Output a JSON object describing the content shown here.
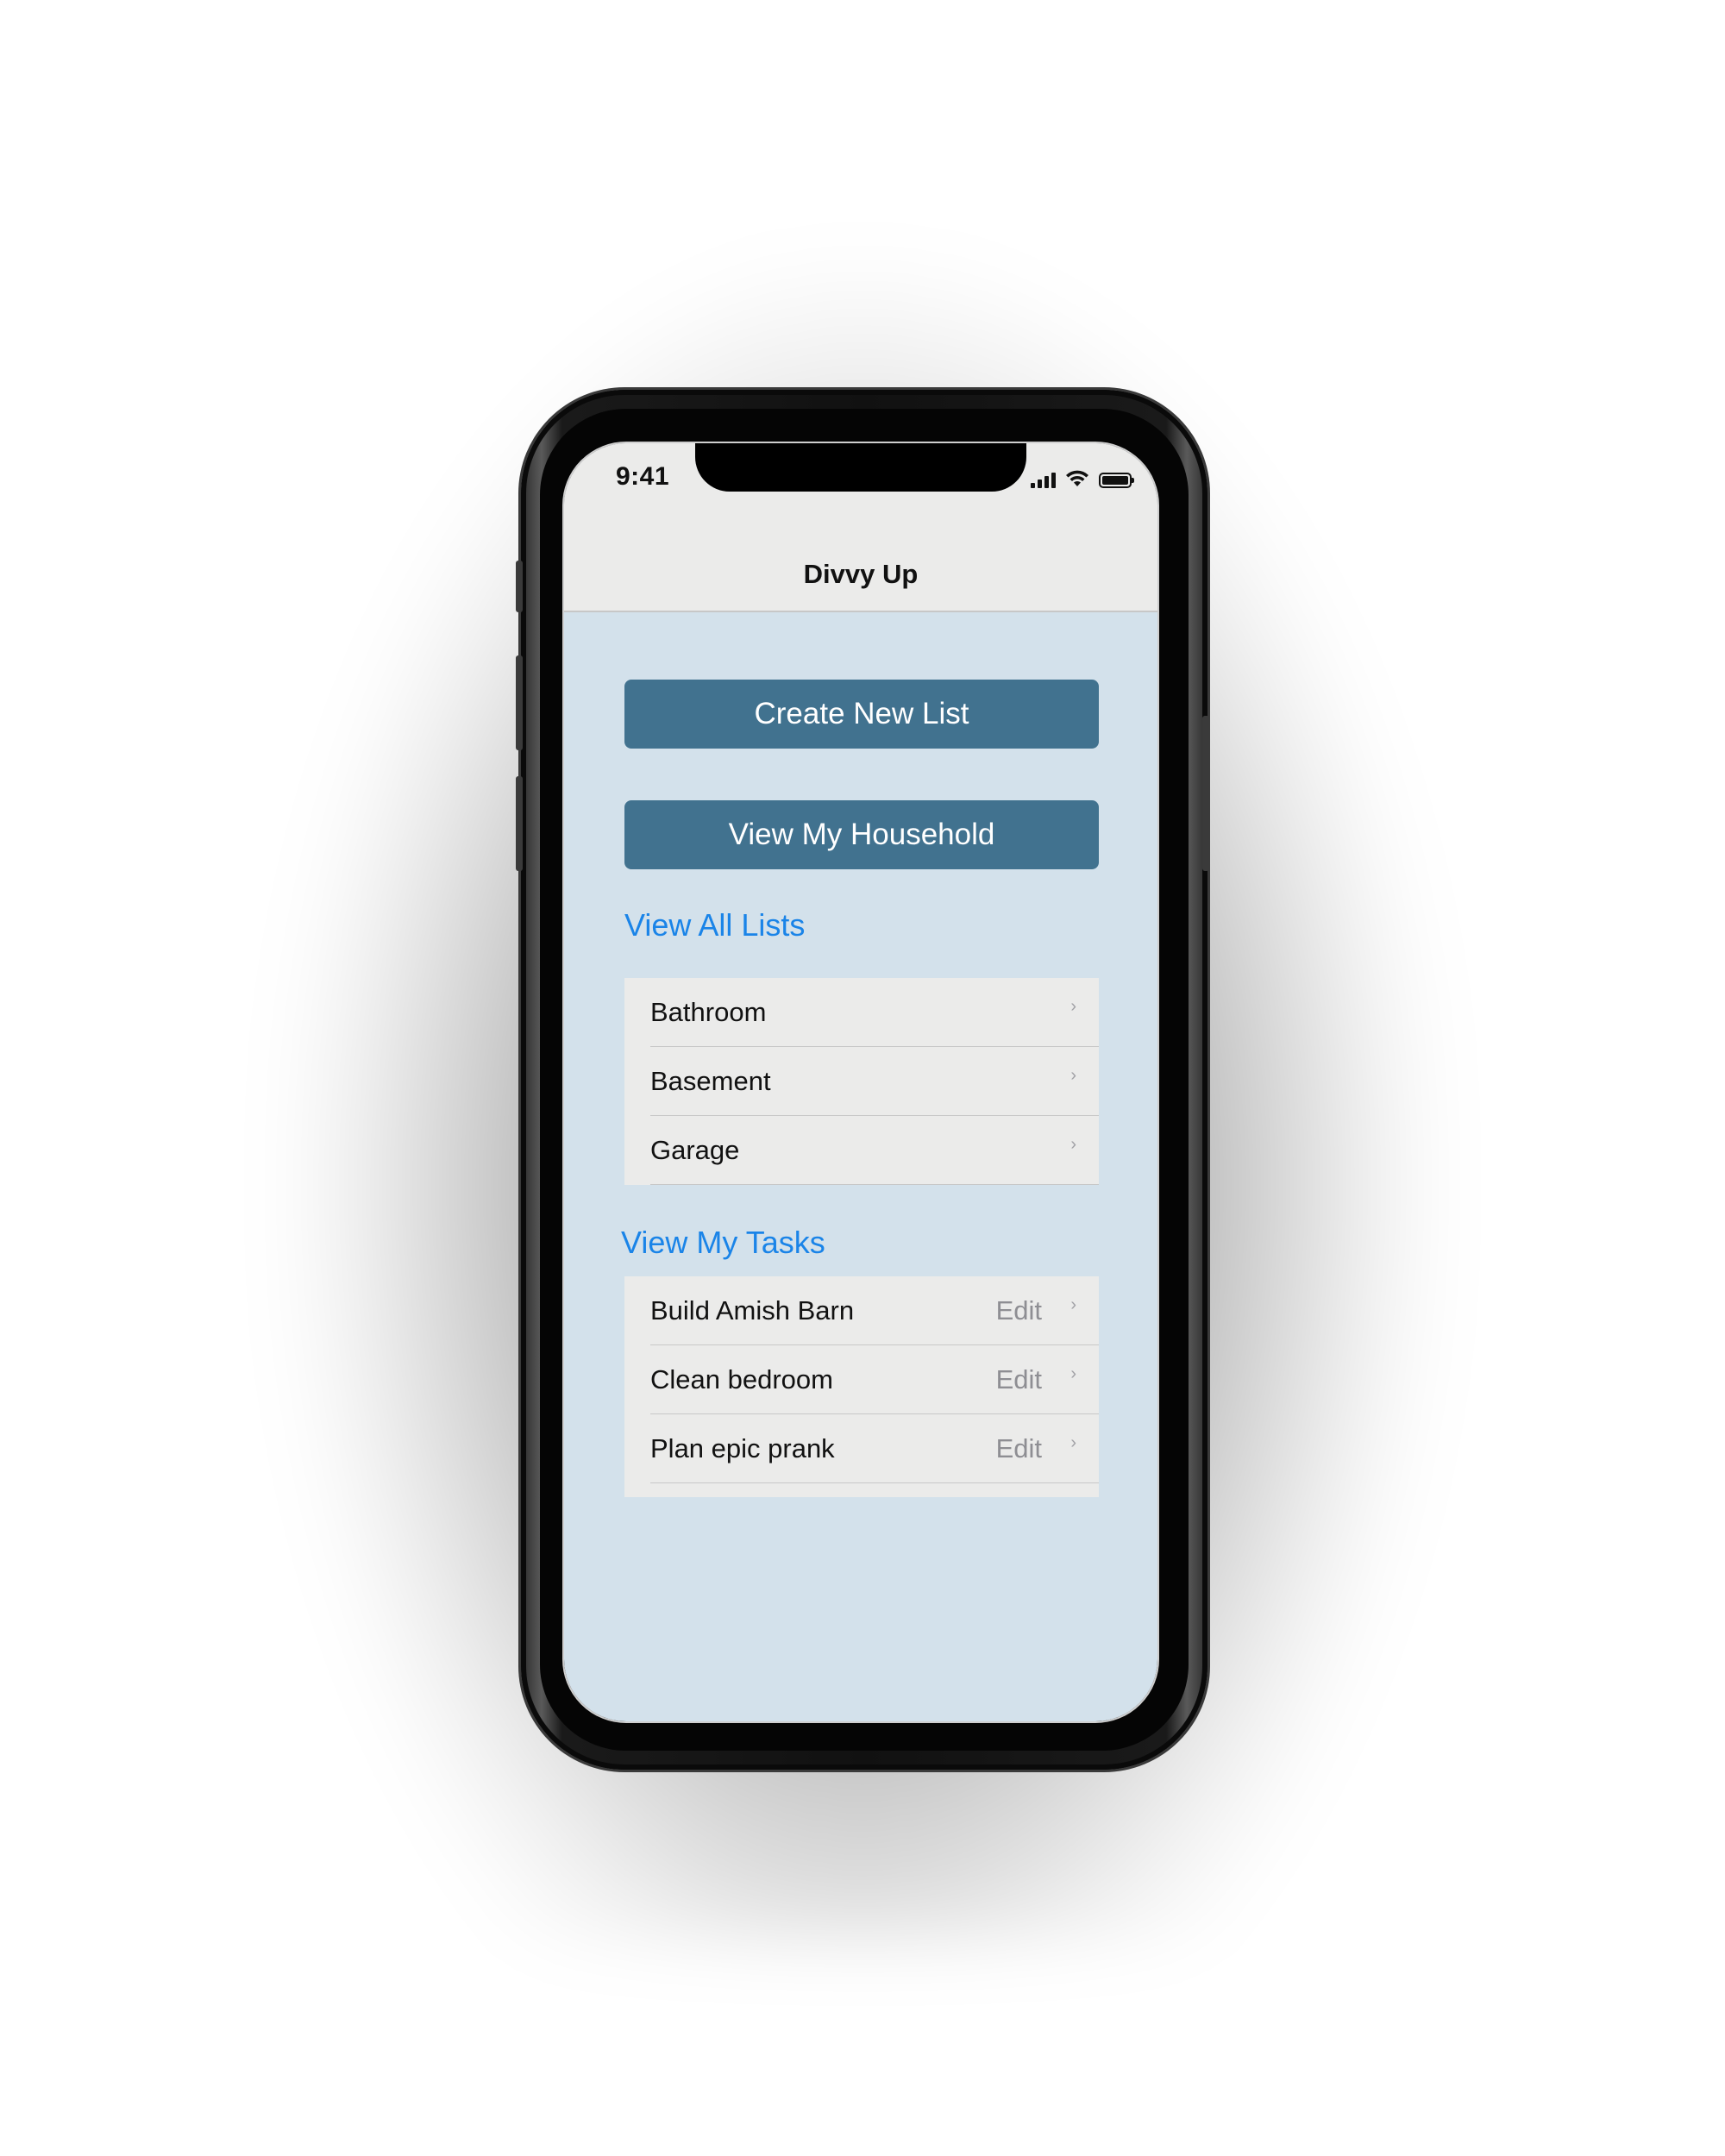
{
  "status_bar": {
    "time": "9:41",
    "signal_icon": "cellular-signal-icon",
    "wifi_icon": "wifi-icon",
    "battery_icon": "battery-icon"
  },
  "nav": {
    "title": "Divvy Up"
  },
  "buttons": {
    "create_new_list": "Create New List",
    "view_my_household": "View My Household"
  },
  "lists_section": {
    "title": "View All Lists",
    "items": [
      {
        "label": "Bathroom"
      },
      {
        "label": "Basement"
      },
      {
        "label": "Garage"
      }
    ]
  },
  "tasks_section": {
    "title": "View My Tasks",
    "items": [
      {
        "label": "Build Amish Barn",
        "action": "Edit"
      },
      {
        "label": "Clean bedroom",
        "action": "Edit"
      },
      {
        "label": "Plan epic prank",
        "action": "Edit"
      }
    ]
  },
  "chevron_glyph": "›",
  "colors": {
    "button_fill": "#41728f",
    "link_blue": "#1a84e8",
    "background": "#d3e1eb",
    "cell_background": "#ebebea"
  }
}
